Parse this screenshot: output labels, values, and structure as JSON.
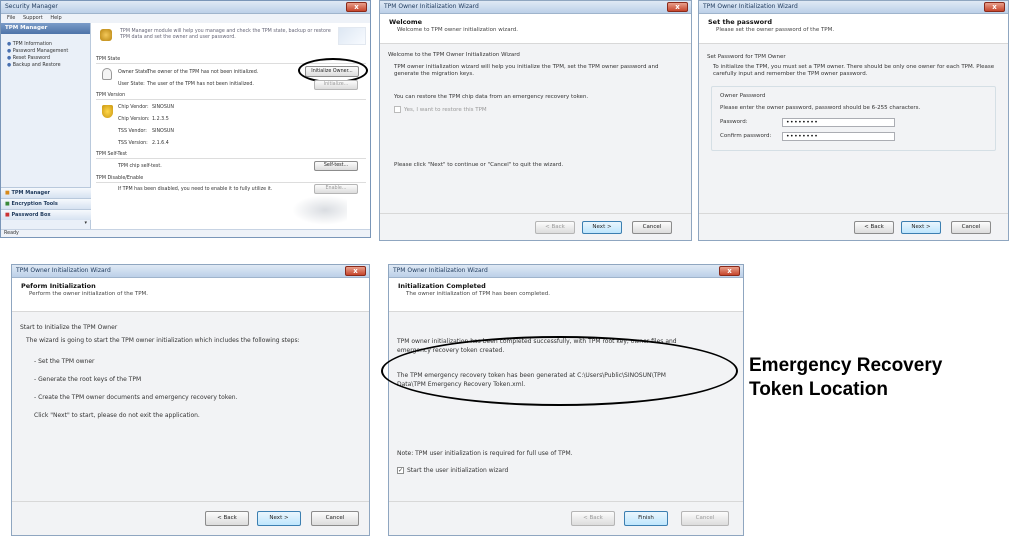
{
  "w1": {
    "title": "Security Manager",
    "menu": [
      "File",
      "Support",
      "Help"
    ],
    "panel_header": "TPM Manager",
    "nav": [
      "TPM Information",
      "Password Management",
      "Reset Password",
      "Backup and Restore"
    ],
    "intro": "TPM Manager module will help you manage and check the TPM state, backup or restore TPM data and set the owner and user password.",
    "sec_state": "TPM State",
    "owner_label": "Owner State:",
    "owner_value": "The owner of the TPM has not been initialized.",
    "user_label": "User State:",
    "user_value": "The user of the TPM has not been initialized.",
    "sec_version": "TPM Version",
    "chip_label": "Chip Vendor:",
    "chip_value": "SINOSUN",
    "chip_ver_label": "Chip Version:",
    "chip_ver_value": "1.2.3.5",
    "tss_label": "TSS Vendor:",
    "tss_value": "SINOSUN",
    "tss_ver_label": "TSS Version:",
    "tss_ver_value": "2.1.6.4",
    "sec_selftest": "TPM Self-Test",
    "selftest_text": "TPM chip self-test.",
    "sec_disable": "TPM Disable/Enable",
    "disable_text": "If TPM has been disabled, you need to enable it to fully utilize it.",
    "btn_initialize": "Initialize Owner...",
    "btn_initialize_user": "Initialize...",
    "btn_selftest": "Self-test...",
    "btn_enable": "Enable...",
    "side": [
      "TPM Manager",
      "Encryption Tools",
      "Password Box"
    ],
    "status": "Ready"
  },
  "w2": {
    "title": "TPM Owner Initialization Wizard",
    "heading": "Welcome",
    "subheading": "Welcome to TPM owner initialization wizard.",
    "section": "Welcome to the TPM Owner Initialization Wizard",
    "body": "TPM owner initialization wizard will help you initialize the TPM, set the TPM owner password and generate the migration keys.",
    "restore": "You can restore the TPM chip data from an emergency recovery token.",
    "checkbox": "Yes, I want to restore this TPM",
    "note": "Please click \"Next\" to continue or \"Cancel\" to quit the wizard.",
    "back": "< Back",
    "next": "Next >",
    "cancel": "Cancel"
  },
  "w3": {
    "title": "TPM Owner Initialization Wizard",
    "heading": "Set the password",
    "subheading": "Please set the owner password of the TPM.",
    "section": "Set Password for TPM Owner",
    "body": "To initialize the TPM, you must set a TPM owner. There should be only one owner for each TPM. Please carefully input and remember the TPM owner password.",
    "group": "Owner Password",
    "hint": "Please enter the owner password, password should be 6-255 characters.",
    "pw_label": "Password:",
    "pw_value": "••••••••",
    "confirm_label": "Confirm password:",
    "confirm_value": "••••••••",
    "back": "< Back",
    "next": "Next >",
    "cancel": "Cancel"
  },
  "w4": {
    "title": "TPM Owner Initialization Wizard",
    "heading": "Peform Initialization",
    "subheading": "Perform the owner initialization of the TPM.",
    "section": "Start to Initialize the TPM Owner",
    "body": "The wizard is going to start the TPM owner initialization which includes the following steps:",
    "steps": [
      "- Set the TPM owner",
      "- Generate the root keys of the TPM",
      "- Create the TPM owner documents and emergency recovery token."
    ],
    "note": "Click \"Next\" to start, please do not exit the application.",
    "back": "< Back",
    "next": "Next >",
    "cancel": "Cancel"
  },
  "w5": {
    "title": "TPM Owner Initialization Wizard",
    "heading": "Initialization Completed",
    "subheading": "The owner initialization of TPM has been completed.",
    "body1": "TPM owner initialization has been completed successfully, with TPM root key, owner files and",
    "body1b": "emergency recovery token created.",
    "body2": "The TPM emergency recovery token has been generated at C:\\Users\\Public\\SINOSUN\\TPM",
    "body2b": "Data\\TPM Emergency Recovery Token.xml.",
    "note": "Note: TPM user initialization is required for full use of TPM.",
    "checkbox": "Start the user initialization wizard",
    "back": "< Back",
    "finish": "Finish",
    "cancel": "Cancel"
  },
  "callout": {
    "line1": "Emergency Recovery",
    "line2": "Token Location"
  }
}
